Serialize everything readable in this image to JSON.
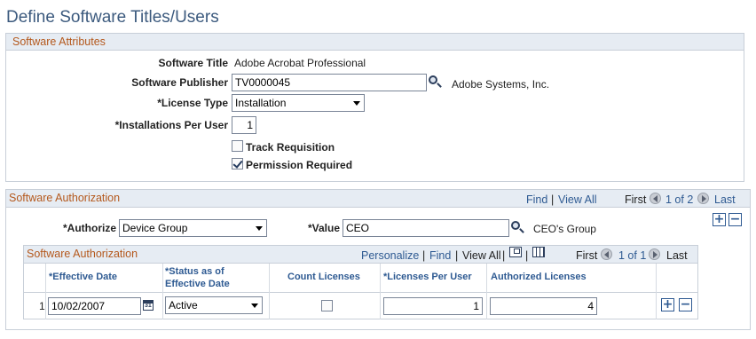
{
  "page": {
    "title": "Define Software Titles/Users"
  },
  "attributes": {
    "header": "Software Attributes",
    "software_title_label": "Software Title",
    "software_title_value": "Adobe Acrobat Professional",
    "publisher_label": "Software Publisher",
    "publisher_value": "TV0000045",
    "publisher_name": "Adobe Systems, Inc.",
    "license_type_label": "*License Type",
    "license_type_value": "Installation",
    "installations_label": "*Installations Per User",
    "installations_value": "1",
    "track_requisition_label": "Track Requisition",
    "track_requisition_checked": false,
    "permission_required_label": "Permission Required",
    "permission_required_checked": true
  },
  "authorization": {
    "header": "Software Authorization",
    "find": "Find",
    "view_all": "View All",
    "first": "First",
    "page_text": "1 of 2",
    "last": "Last",
    "authorize_label": "*Authorize",
    "authorize_value": "Device Group",
    "value_label": "*Value",
    "value_value": "CEO",
    "value_description": "CEO's Group"
  },
  "grid": {
    "header": "Software Authorization",
    "personalize": "Personalize",
    "find": "Find",
    "view_all": "View All",
    "first": "First",
    "page_text": "1 of 1",
    "last": "Last",
    "columns": {
      "effective_date": "*Effective Date",
      "status": "*Status as of Effective Date",
      "count_licenses": "Count Licenses",
      "licenses_per_user": "*Licenses Per User",
      "authorized_licenses": "Authorized Licenses"
    },
    "rows": [
      {
        "row_num": "1",
        "effective_date": "10/02/2007",
        "status": "Active",
        "count_licenses": false,
        "licenses_per_user": "1",
        "authorized_licenses": "4"
      }
    ]
  }
}
